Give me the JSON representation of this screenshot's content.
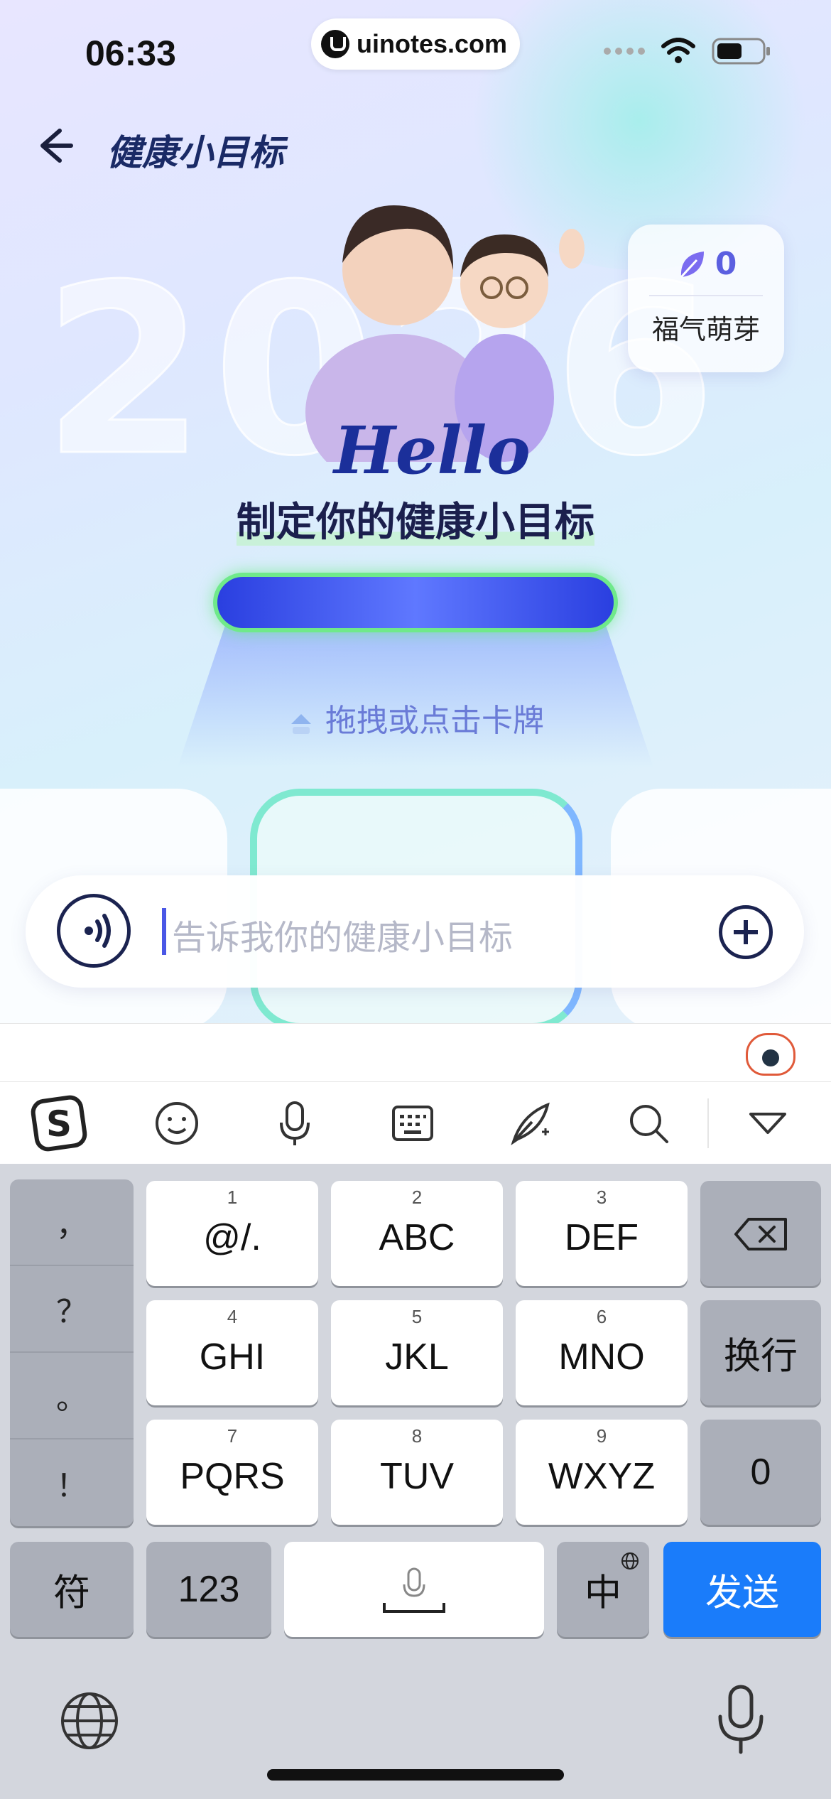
{
  "status_bar": {
    "time": "06:33",
    "url": "uinotes.com"
  },
  "header": {
    "back_icon": "arrow-left-icon",
    "title": "健康小目标"
  },
  "hero": {
    "year_text": "2026",
    "hello": "Hello",
    "subtitle": "制定你的健康小目标"
  },
  "fortune": {
    "icon": "leaf-icon",
    "count": "0",
    "label": "福气萌芽"
  },
  "card_slot": {
    "hint": "拖拽或点击卡牌"
  },
  "input": {
    "placeholder": "告诉我你的健康小目标"
  },
  "keyboard": {
    "toolbar": [
      "sogou-logo-icon",
      "emoji-icon",
      "mic-icon",
      "keyboard-icon",
      "handwriting-icon",
      "search-icon",
      "collapse-icon"
    ],
    "punctuation": [
      "，",
      "？",
      "。",
      "！"
    ],
    "keys": [
      {
        "num": "1",
        "label": "@/."
      },
      {
        "num": "2",
        "label": "ABC"
      },
      {
        "num": "3",
        "label": "DEF"
      },
      {
        "num": "4",
        "label": "GHI"
      },
      {
        "num": "5",
        "label": "JKL"
      },
      {
        "num": "6",
        "label": "MNO"
      },
      {
        "num": "7",
        "label": "PQRS"
      },
      {
        "num": "8",
        "label": "TUV"
      },
      {
        "num": "9",
        "label": "WXYZ"
      }
    ],
    "newline": "换行",
    "zero": "0",
    "symbols": "符",
    "numbers": "123",
    "chinese": "中",
    "send": "发送"
  }
}
